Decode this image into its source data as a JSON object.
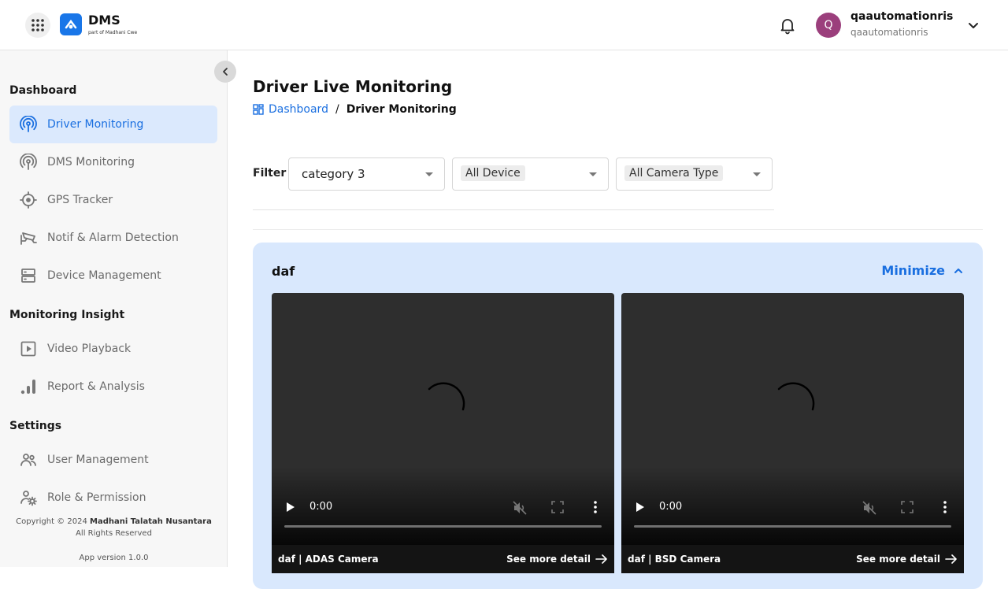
{
  "header": {
    "brand_name": "DMS",
    "brand_sub": "part of Madhani Cwe",
    "user_name": "qaautomationris",
    "user_sub": "qaautomationris",
    "avatar_letter": "Q"
  },
  "sidebar": {
    "sections": [
      {
        "title": "Dashboard"
      },
      {
        "title": "Monitoring Insight"
      },
      {
        "title": "Settings"
      }
    ],
    "items": [
      {
        "label": "Driver Monitoring",
        "icon": "broadcast-icon",
        "active": true
      },
      {
        "label": "DMS Monitoring",
        "icon": "broadcast-icon"
      },
      {
        "label": "GPS Tracker",
        "icon": "crosshair-icon"
      },
      {
        "label": "Notif & Alarm Detection",
        "icon": "cctv-icon"
      },
      {
        "label": "Device Management",
        "icon": "server-icon"
      },
      {
        "label": "Video Playback",
        "icon": "play-square-icon"
      },
      {
        "label": "Report & Analysis",
        "icon": "bar-chart-icon"
      },
      {
        "label": "User Management",
        "icon": "users-icon"
      },
      {
        "label": "Role & Permission",
        "icon": "user-gear-icon"
      }
    ],
    "footer": {
      "copyright": "Copyright © 2024",
      "company": "Madhani Talatah Nusantara",
      "rights": "All Rights Reserved",
      "version": "App version 1.0.0"
    }
  },
  "main": {
    "title": "Driver Live Monitoring",
    "breadcrumb": {
      "home": "Dashboard",
      "separator": "/",
      "current": "Driver Monitoring"
    },
    "filter": {
      "label": "Filter",
      "category": "category 3",
      "device": "All Device",
      "camera_type": "All Camera Type"
    },
    "group": {
      "title": "daf",
      "minimize_label": "Minimize",
      "videos": [
        {
          "caption": "daf | ADAS Camera",
          "time": "0:00",
          "detail_label": "See more detail"
        },
        {
          "caption": "daf | BSD Camera",
          "time": "0:00",
          "detail_label": "See more detail"
        }
      ]
    }
  },
  "colors": {
    "accent": "#1a6fe0",
    "active_bg": "#dbe9fd",
    "group_bg": "#d9e8fd",
    "avatar": "#9b3f7c"
  }
}
